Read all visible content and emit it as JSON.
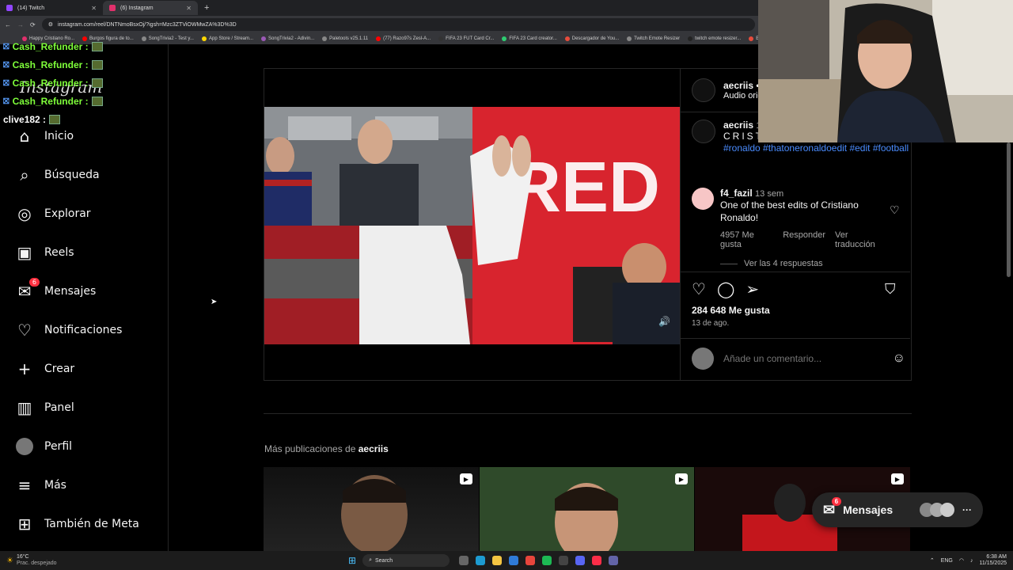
{
  "browser": {
    "tabs": [
      {
        "label": "(14) Twitch",
        "color": "#9146ff"
      },
      {
        "label": "(6) Instagram",
        "color": "#e1306c"
      }
    ],
    "new_tab": "+",
    "url": "instagram.com/reel/DNTNmoBsxOj/?igsh=Mzc3ZTViOWMwZA%3D%3D",
    "bookmarks": [
      {
        "label": "Happy Cristiano Ro...",
        "color": "#e1306c"
      },
      {
        "label": "Burgos figura de to...",
        "color": "#ff0000"
      },
      {
        "label": "SongTrivia2 - Test y...",
        "color": "#888888"
      },
      {
        "label": "App Store / Stream...",
        "color": "#ffd700"
      },
      {
        "label": "SongTrivia2 - Adivin...",
        "color": "#9b59b6"
      },
      {
        "label": "Paletools v25.1.11",
        "color": "#888888"
      },
      {
        "label": "(77) Razo97s Zesl-A...",
        "color": "#ff0000"
      },
      {
        "label": "FIFA 23 FUT Card Cr...",
        "color": "#333333"
      },
      {
        "label": "FIFA 23 Card creator...",
        "color": "#2ecc71"
      },
      {
        "label": "Descargador de You...",
        "color": "#e74c3c"
      },
      {
        "label": "Twitch Emote Resizer",
        "color": "#888888"
      },
      {
        "label": "twitch emote resizer...",
        "color": "#222222"
      },
      {
        "label": "Est",
        "color": "#e74c3c"
      }
    ]
  },
  "chat": [
    {
      "user": "Cash_Refunder :",
      "color": "#7fff3a"
    },
    {
      "user": "Cash_Refunder :",
      "color": "#7fff3a"
    },
    {
      "user": "Cash_Refunder :",
      "color": "#7fff3a"
    },
    {
      "user": "Cash_Refunder :",
      "color": "#7fff3a"
    },
    {
      "user": "clive182 :",
      "color": "#ffffff"
    }
  ],
  "sidebar": {
    "logo": "Instagram",
    "items": [
      {
        "label": "Inicio",
        "icon": "home-icon"
      },
      {
        "label": "Búsqueda",
        "icon": "search-icon"
      },
      {
        "label": "Explorar",
        "icon": "compass-icon"
      },
      {
        "label": "Reels",
        "icon": "reels-icon"
      },
      {
        "label": "Mensajes",
        "icon": "messenger-icon",
        "badge": "6"
      },
      {
        "label": "Notificaciones",
        "icon": "heart-icon"
      },
      {
        "label": "Crear",
        "icon": "plus-icon"
      },
      {
        "label": "Panel",
        "icon": "chart-icon"
      },
      {
        "label": "Perfil",
        "icon": "avatar-icon"
      },
      {
        "label": "Más",
        "icon": "menu-icon"
      },
      {
        "label": "También de Meta",
        "icon": "meta-icon"
      }
    ]
  },
  "post": {
    "author": "aecriis",
    "dot": "•",
    "audio": "Audio orig",
    "video_text": "RED",
    "caption_author": "aecriis",
    "caption_time": "13",
    "caption_text": "CRISTIANO",
    "hashtags": "#ronaldo #thatoneronaldoedit #edit #football",
    "comment": {
      "user": "f4_fazil",
      "time": "13 sem",
      "text": "One of the best edits of Cristiano Ronaldo!",
      "likes": "4957 Me gusta",
      "reply": "Responder",
      "translate": "Ver traducción",
      "replies": "Ver las 4 respuestas"
    },
    "likes": "284 648 Me gusta",
    "date": "13 de ago.",
    "comment_placeholder": "Añade un comentario..."
  },
  "more": {
    "title_prefix": "Más publicaciones de",
    "title_user": "aecriis",
    "thumbs": [
      "reel-thumbnail-1",
      "reel-thumbnail-2",
      "reel-thumbnail-3"
    ]
  },
  "messages_pill": {
    "label": "Mensajes",
    "badge": "6"
  },
  "taskbar": {
    "weather_temp": "16°C",
    "weather_desc": "Prac. despejado",
    "search": "Search",
    "lang": "ENG",
    "time": "6:38 AM",
    "date": "11/15/2025"
  },
  "colors": {
    "accent": "#0095f6",
    "badge": "#ff3040",
    "hashtag": "#4a8cff"
  }
}
